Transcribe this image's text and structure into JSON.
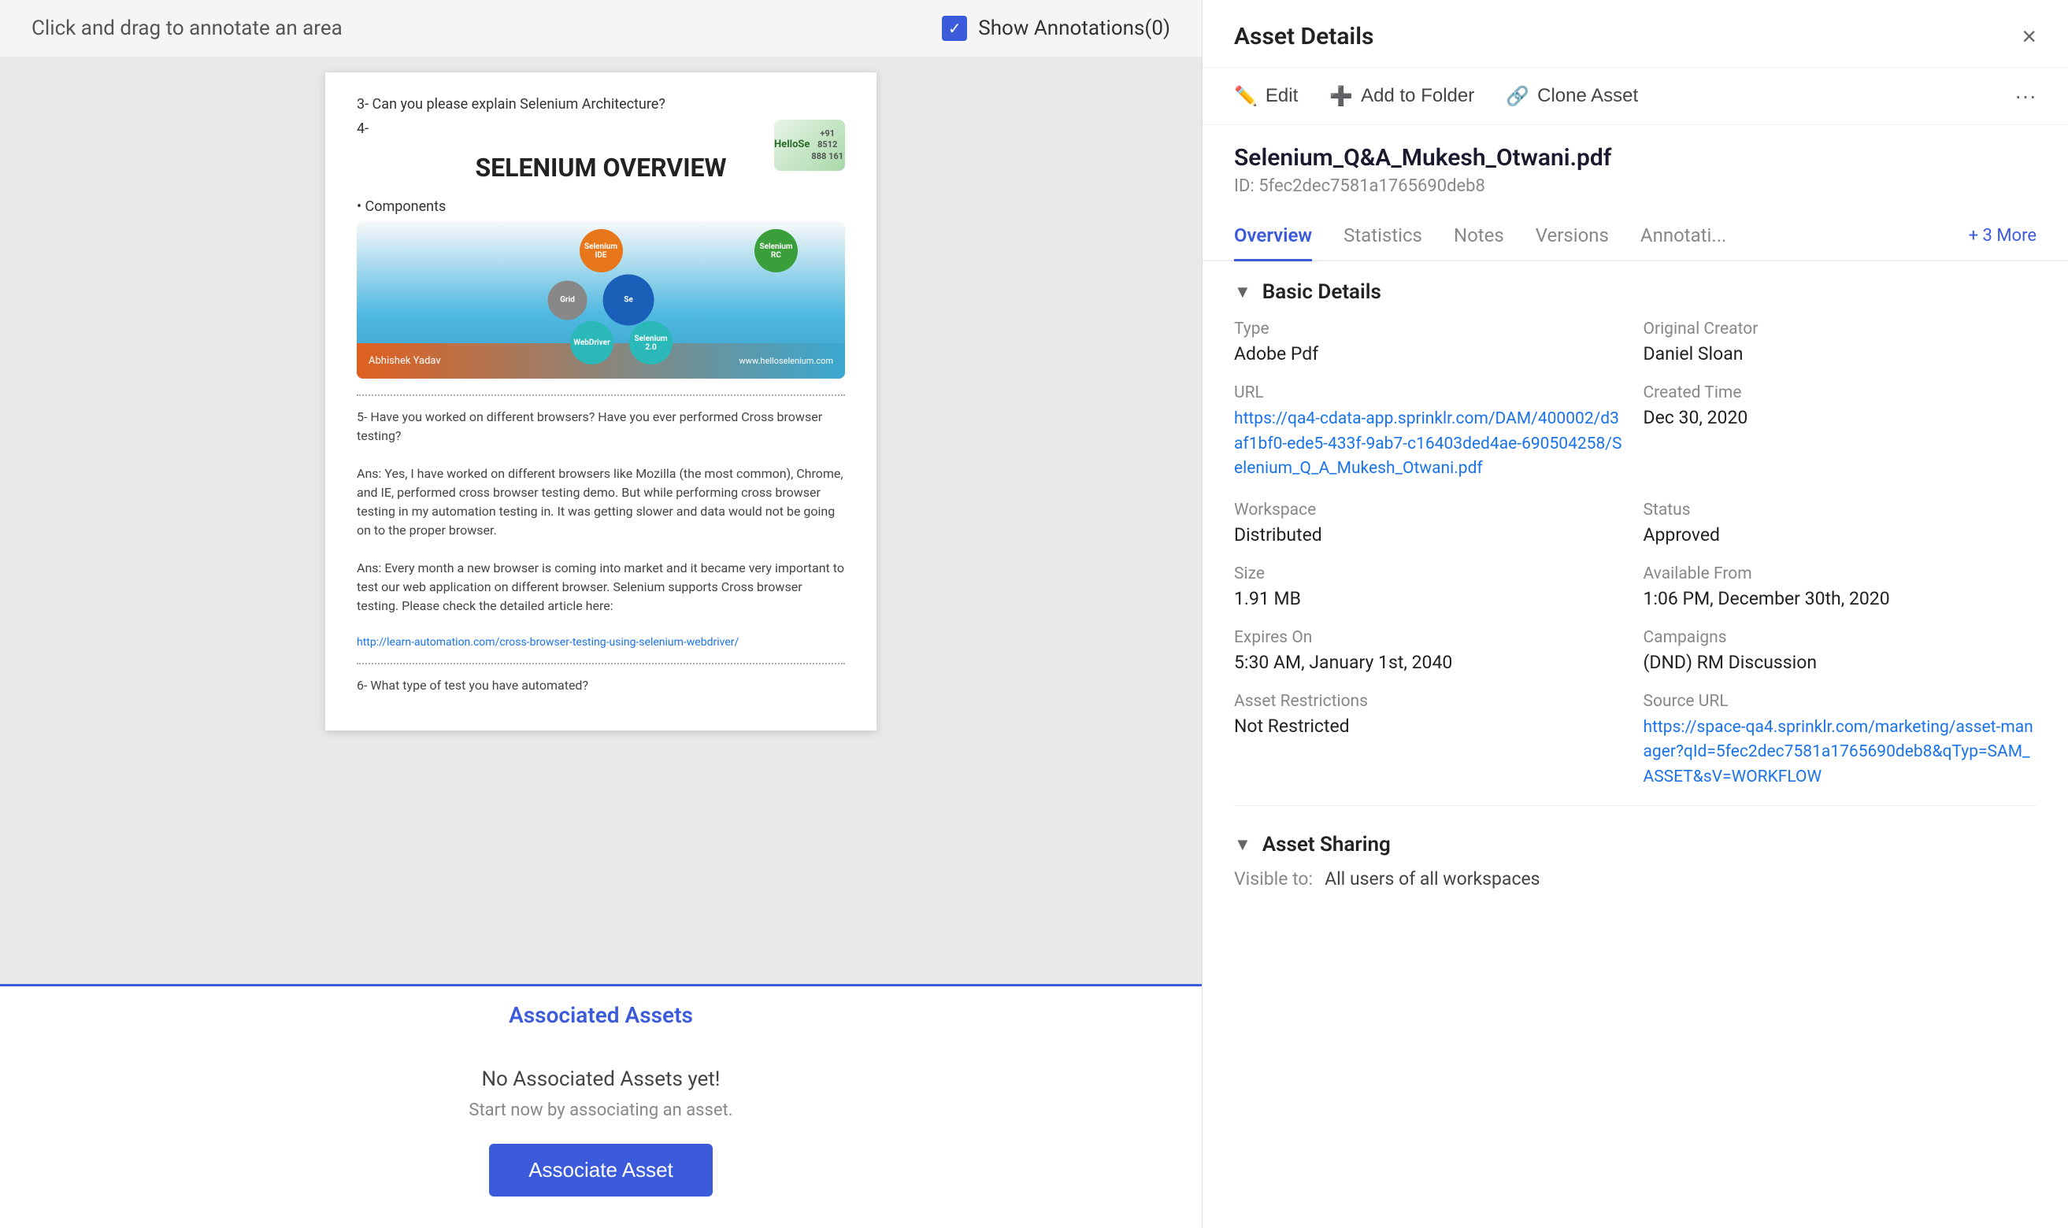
{
  "topBar": {
    "annotationHint": "Click and drag to annotate an area",
    "showAnnotationsLabel": "Show Annotations(0)",
    "checkboxChecked": true
  },
  "docPreview": {
    "questions": [
      "3-  Can you please explain Selenium Architecture?",
      "4-"
    ],
    "title": "SELENIUM OVERVIEW",
    "logo": "HelloSe\n+91 8512 888 161",
    "componentsLabel": "• Components",
    "circles": [
      {
        "label": "Selenium\nIDE",
        "color": "orange"
      },
      {
        "label": "Se",
        "color": "blue"
      },
      {
        "label": "Selenium\nRC",
        "color": "green"
      },
      {
        "label": "WebDriver",
        "color": "teal"
      },
      {
        "label": "Selenium\n2.0",
        "color": "teal"
      }
    ],
    "question5": "5-  Have you worked on different browsers? Have you ever performed Cross browser testing?",
    "ans1": "Ans: Yes, I have worked on different browsers like Mozilla (the most common), Chrome, and IE, performed cross browser testing demo. But while performing cross browser testing in my automation testing in. It was getting slower and data would not be going on to the proper browser.",
    "ans2": "Ans: Every month a new browser is coming into market and it became very important to test our web application on different browser. Selenium supports Cross browser testing. Please check the detailed article here:",
    "docLink": "http://learn-automation.com/cross-browser-testing-using-selenium-webdriver/",
    "question6": "6-  What type of test you have automated?"
  },
  "associatedAssets": {
    "sectionLabel": "Associated Assets",
    "emptyTitle": "No Associated Assets yet!",
    "emptySubtitle": "Start now by associating an asset.",
    "buttonLabel": "Associate Asset"
  },
  "rightPanel": {
    "title": "Asset Details",
    "closeIcon": "×",
    "actions": {
      "editLabel": "Edit",
      "addToFolderLabel": "Add to Folder",
      "cloneAssetLabel": "Clone Asset",
      "moreLabel": "···"
    },
    "assetName": "Selenium_Q&A_Mukesh_Otwani.pdf",
    "assetId": "ID: 5fec2dec7581a1765690deb8",
    "tabs": [
      {
        "label": "Overview",
        "active": true
      },
      {
        "label": "Statistics",
        "active": false
      },
      {
        "label": "Notes",
        "active": false
      },
      {
        "label": "Versions",
        "active": false
      },
      {
        "label": "Annotati...",
        "active": false
      }
    ],
    "tabMore": "+ 3 More",
    "basicDetails": {
      "sectionTitle": "Basic Details",
      "typeLabel": "Type",
      "typeValue": "Adobe Pdf",
      "originalCreatorLabel": "Original Creator",
      "originalCreatorValue": "Daniel Sloan",
      "urlLabel": "URL",
      "urlValue": "https://qa4-cdata-app.sprinklr.com/DAM/400002/d3af1bf0-ede5-433f-9ab7-c16403ded4ae-690504258/Selenium_Q_A_Mukesh_Otwani.pdf",
      "createdTimeLabel": "Created Time",
      "createdTimeValue": "Dec 30, 2020",
      "workspaceLabel": "Workspace",
      "workspaceValue": "Distributed",
      "statusLabel": "Status",
      "statusValue": "Approved",
      "sizeLabel": "Size",
      "sizeValue": "1.91 MB",
      "availableFromLabel": "Available From",
      "availableFromValue": "1:06 PM, December 30th, 2020",
      "expiresOnLabel": "Expires On",
      "expiresOnValue": "5:30 AM, January 1st, 2040",
      "campaignsLabel": "Campaigns",
      "campaignsValue": "(DND) RM Discussion",
      "assetRestrictionsLabel": "Asset Restrictions",
      "assetRestrictionsValue": "Not Restricted",
      "sourceUrlLabel": "Source URL",
      "sourceUrlValue": "https://space-qa4.sprinklr.com/marketing/asset-manager?qId=5fec2dec7581a1765690deb8&qTyp=SAM_ASSET&sV=WORKFLOW"
    },
    "assetSharing": {
      "sectionTitle": "Asset Sharing",
      "visibleToLabel": "Visible to:",
      "visibleToValue": "All users of all workspaces"
    }
  }
}
